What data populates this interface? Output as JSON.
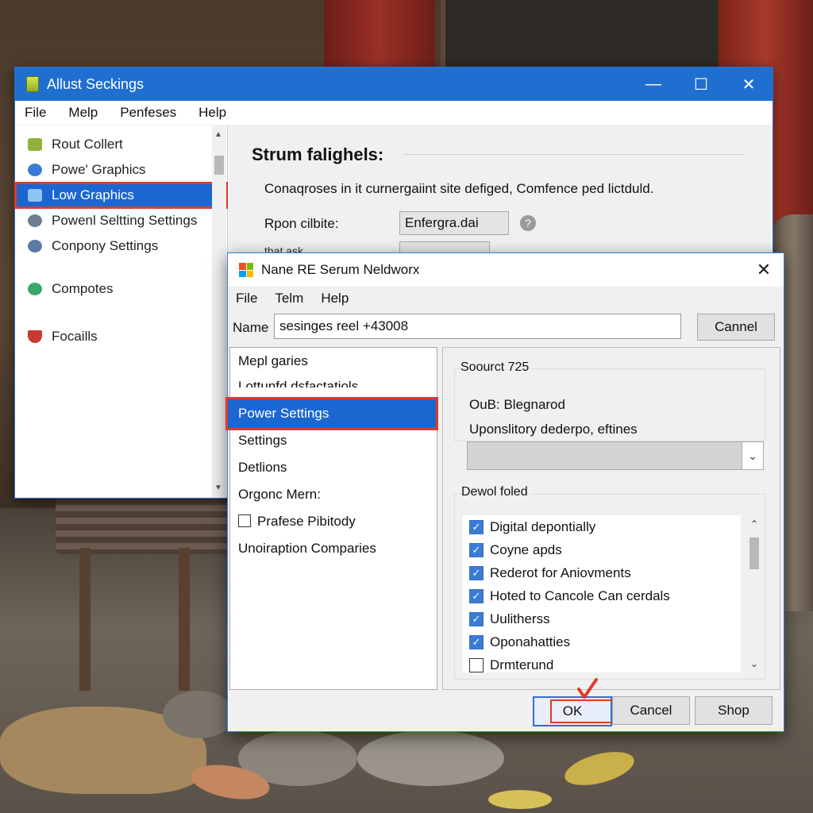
{
  "colors": {
    "accent": "#1b67d1",
    "titlebar": "#1f6fd1",
    "highlight_box": "#e03a2b"
  },
  "window1": {
    "title": "Allust Seckings",
    "icon": "app-icon",
    "controls": {
      "minimize": "—",
      "maximize": "☐",
      "close": "✕"
    },
    "menu": [
      "File",
      "Melp",
      "Penfeses",
      "Help"
    ],
    "sidebar": [
      {
        "label": "Rout Collert",
        "icon": "folder-icon",
        "color": "#8fb03a"
      },
      {
        "label": "Powe' Graphics",
        "icon": "graphics-icon",
        "color": "#3a7bd5"
      },
      {
        "label": "Low Graphics",
        "icon": "monitor-icon",
        "color": "#5aa0e6",
        "selected": true
      },
      {
        "label": "Powenl Seltting Settings",
        "icon": "gear-icon",
        "color": "#6f7f91"
      },
      {
        "label": "Conpony Settings",
        "icon": "settings-icon",
        "color": "#5b79a6"
      },
      {
        "label": "Compotes",
        "icon": "globe-icon",
        "color": "#3aa86a"
      },
      {
        "label": "Focaills",
        "icon": "shield-icon",
        "color": "#c83b32"
      }
    ],
    "main": {
      "heading": "Strum falighels:",
      "description": "Conaqroses in it curnergaiint site defiged, Comfence ped lictduld.",
      "field_label": "Rpon cilbite:",
      "field_value": "Enfergra.dai",
      "help_icon": "?",
      "field2_label": "that ask"
    }
  },
  "dialog": {
    "title": "Nane RE Serum Neldworx",
    "menu": [
      "File",
      "Telm",
      "Help"
    ],
    "name_label": "Name",
    "name_value": "sesinges reel +43008",
    "cannel_button": "Cannel",
    "close_icon": "✕",
    "left_list": [
      {
        "label": "Mepl garies"
      },
      {
        "label": "Lottunfd dsfactatiols"
      },
      {
        "label": "Power Settings",
        "selected": true
      },
      {
        "label": "Settings"
      },
      {
        "label": "Detlions"
      },
      {
        "label": "Orgonc Mern:"
      },
      {
        "label": "Prafese Pibitody",
        "checkbox": true
      },
      {
        "label": "Unoiraption Comparies"
      }
    ],
    "group1": {
      "title": "Soourct 725",
      "line1": "OuB: Blegnarod",
      "line2": "Uponslitory dederpo, eftines"
    },
    "combo_arrow": "⌄",
    "group2": {
      "title": "Dewol foled",
      "items": [
        {
          "label": "Digital depontially",
          "checked": true
        },
        {
          "label": "Coyne apds",
          "checked": true
        },
        {
          "label": "Rederot for Aniovments",
          "checked": true
        },
        {
          "label": "Hoted to Cancole Can cerdals",
          "checked": true
        },
        {
          "label": "Uulitherss",
          "checked": true
        },
        {
          "label": "Oponahatties",
          "checked": true
        },
        {
          "label": "Drmterund",
          "checked": false
        }
      ]
    },
    "buttons": {
      "ok": "OK",
      "cancel": "Cancel",
      "shop": "Shop"
    }
  }
}
